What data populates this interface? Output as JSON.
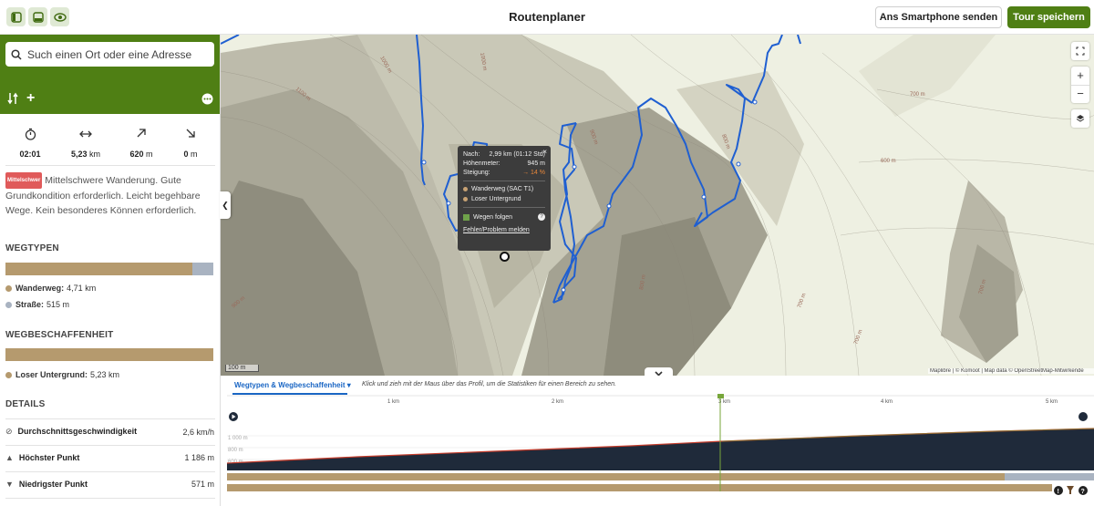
{
  "header": {
    "title": "Routenplaner",
    "send_label": "Ans Smartphone senden",
    "save_label": "Tour speichern"
  },
  "search": {
    "placeholder": "Such einen Ort oder eine Adresse"
  },
  "stats": [
    {
      "icon": "stopwatch-icon",
      "value": "02:01",
      "unit": ""
    },
    {
      "icon": "distance-icon",
      "value": "5,23",
      "unit": "km"
    },
    {
      "icon": "ascent-icon",
      "value": "620",
      "unit": "m"
    },
    {
      "icon": "descent-icon",
      "value": "0",
      "unit": "m"
    }
  ],
  "difficulty": {
    "badge": "Mittelschwer",
    "text": "Mittelschwere Wanderung. Gute Grundkondition erforderlich. Leicht begehbare Wege. Kein besonderes Können erforderlich."
  },
  "wegtypen": {
    "title": "WEGTYPEN",
    "items": [
      {
        "label": "Wanderweg:",
        "value": "4,71 km",
        "color": "#b59a6e",
        "fraction": 0.9
      },
      {
        "label": "Straße:",
        "value": "515 m",
        "color": "#a9b3c1",
        "fraction": 0.1
      }
    ]
  },
  "wegbeschaffenheit": {
    "title": "WEGBESCHAFFENHEIT",
    "items": [
      {
        "label": "Loser Untergrund:",
        "value": "5,23 km",
        "color": "#b59a6e",
        "fraction": 1.0
      }
    ]
  },
  "details": {
    "title": "DETAILS",
    "rows": [
      {
        "icon": "speed-icon",
        "label": "Durchschnittsgeschwindigkeit",
        "value": "2,6 km/h"
      },
      {
        "icon": "highest-point-icon",
        "label": "Höchster Punkt",
        "value": "1 186 m"
      },
      {
        "icon": "lowest-point-icon",
        "label": "Niedrigster Punkt",
        "value": "571 m"
      }
    ]
  },
  "map": {
    "scale": "100 m",
    "attribution": "Maplibre | © Komoot | Map data © OpenStreetMap-Mitwirkende",
    "contours": [
      "1100 m",
      "1000 m",
      "900 m",
      "800 m",
      "700 m",
      "600 m",
      "700 m",
      "700 m",
      "700 m",
      "800 m",
      "900 m",
      "1000 m"
    ],
    "colors": {
      "route": "#1f5fd1",
      "terrain_light": "#eef0e2",
      "terrain_dark": "#a8a89a"
    }
  },
  "popup": {
    "rows": [
      {
        "label": "Nach:",
        "value": "2,99 km (01:12 Std)"
      },
      {
        "label": "Höhenmeter:",
        "value": "945 m"
      },
      {
        "label": "Steigung:",
        "value": "→ 14 %"
      }
    ],
    "legend": [
      {
        "label": "Wanderweg (SAC T1)",
        "color": "#c8a274"
      },
      {
        "label": "Loser Untergrund",
        "color": "#c8a274"
      }
    ],
    "follow": "Wegen folgen",
    "report": "Fehler/Problem melden"
  },
  "profile": {
    "tab_label": "Wegtypen & Wegbeschaffenheit",
    "hint": "Klick und zieh mit der Maus über das Profil, um die Statistiken für einen Bereich zu sehen.",
    "km_ticks": [
      "1 km",
      "2 km",
      "3 km",
      "4 km",
      "5 km"
    ],
    "y_labels": [
      "1 000 m",
      "800 m",
      "600 m"
    ]
  }
}
